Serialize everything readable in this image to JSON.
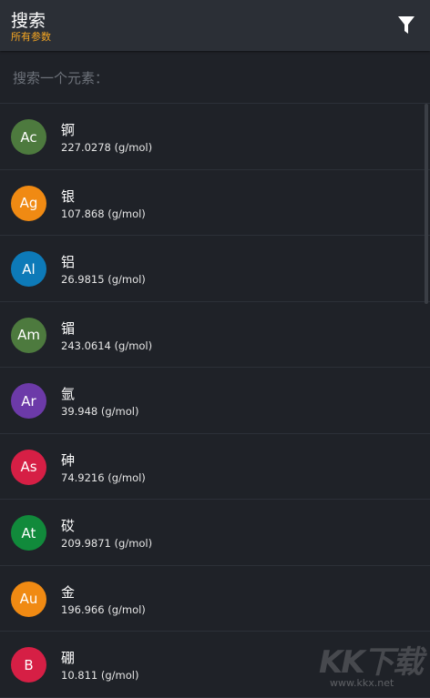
{
  "appbar": {
    "title": "搜索",
    "subtitle": "所有参数",
    "filter_icon": "filter-icon"
  },
  "search": {
    "placeholder": "搜索一个元素："
  },
  "elements": [
    {
      "symbol": "Ac",
      "name": "锕",
      "mass": "227.0278 (g/mol)",
      "color": "#4d7a3e"
    },
    {
      "symbol": "Ag",
      "name": "银",
      "mass": "107.868 (g/mol)",
      "color": "#f08a13"
    },
    {
      "symbol": "Al",
      "name": "铝",
      "mass": "26.9815 (g/mol)",
      "color": "#0d7ab8"
    },
    {
      "symbol": "Am",
      "name": "镅",
      "mass": "243.0614 (g/mol)",
      "color": "#4d7a3e"
    },
    {
      "symbol": "Ar",
      "name": "氩",
      "mass": "39.948 (g/mol)",
      "color": "#6c3aa8"
    },
    {
      "symbol": "As",
      "name": "砷",
      "mass": "74.9216 (g/mol)",
      "color": "#d61f45"
    },
    {
      "symbol": "At",
      "name": "砹",
      "mass": "209.9871 (g/mol)",
      "color": "#118a3b"
    },
    {
      "symbol": "Au",
      "name": "金",
      "mass": "196.966 (g/mol)",
      "color": "#f08a13"
    },
    {
      "symbol": "B",
      "name": "硼",
      "mass": "10.811 (g/mol)",
      "color": "#d61f45"
    }
  ],
  "watermark": {
    "text": "KK下载",
    "url": "www.kkx.net"
  }
}
